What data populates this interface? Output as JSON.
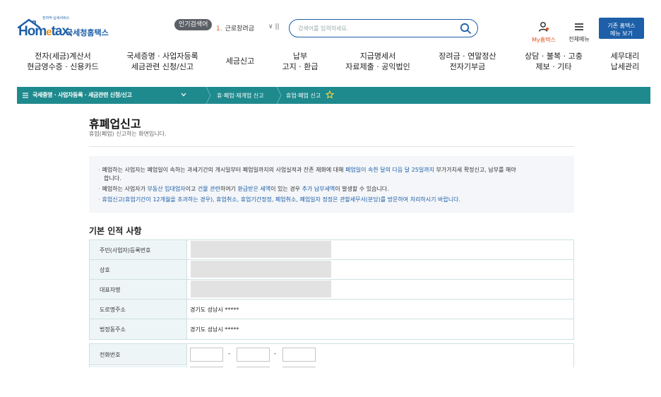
{
  "header": {
    "logo_tagline": "전자적 납세서비스",
    "logo_text_a": "Hom",
    "logo_text_e": "e",
    "logo_text_b": "tax.",
    "logo_kr": "국세청홈택스",
    "popular_badge": "인기검색어",
    "popular_rank": "1.",
    "popular_term": "근로장려금",
    "popular_ctrl": "∨  ||",
    "search_placeholder": "검색어를 입력하세요.",
    "my_hometax": "My홈택스",
    "all_menu": "전체메뉴",
    "legacy_line1": "기존 홈택스",
    "legacy_line2": "메뉴 보기"
  },
  "gnb": [
    {
      "line1": "전자(세금)계산서",
      "line2": "현금영수증 · 신용카드"
    },
    {
      "line1": "국세증명 · 사업자등록",
      "line2": "세금관련 신청/신고"
    },
    {
      "line1": "세금신고",
      "line2": ""
    },
    {
      "line1": "납부",
      "line2": "고지 · 환급"
    },
    {
      "line1": "지급명세서",
      "line2": "자료제출 · 공익법인"
    },
    {
      "line1": "장려금 · 연말정산",
      "line2": "전자기부금"
    },
    {
      "line1": "상담 · 불복 · 고충",
      "line2": "제보 · 기타"
    },
    {
      "line1": "세무대리",
      "line2": "납세관리"
    }
  ],
  "breadcrumb": {
    "level1": "국세증명 · 사업자등록 · 세금관련 신청/신고",
    "level2": "휴·폐업·재개업 신고",
    "level3": "휴업·폐업 신고"
  },
  "page": {
    "title": "휴폐업신고",
    "description": "휴업(폐업) 신고하는 화면입니다."
  },
  "notice": {
    "line1_a": "폐업하는 사업자는 폐업일이 속하는 과세기간의 개시일부터 폐업일까지의 사업실적과 잔존 재화에 대해 ",
    "line1_hl": "폐업일이 속한 달의 다음 달 25일까지",
    "line1_b": " 부가가치세 확정신고, 납부를 해야",
    "line1_c": "합니다.",
    "line2_a": "폐업하는 사업자가 ",
    "line2_hl1": "부동산 임대업자",
    "line2_b": "이고 ",
    "line2_hl2": "건물 관련",
    "line2_c": "하여기 ",
    "line2_hl3": "환급받은 세액",
    "line2_d": "이 있는 경우 ",
    "line2_hl4": "추가 납부세액",
    "line2_e": "이 발생할 수 있습니다.",
    "line3": "휴업신고(휴업기간이 12개월을 초과하는 경우), 휴업취소, 휴업기간정정, 폐업취소, 폐업일자 정정은 관할세무서(분당)를 방문하여 처리하시기 바랍니다."
  },
  "section": {
    "title": "기본 인적 사항",
    "rows": [
      {
        "label": "주민(사업자)등록번호",
        "value": ""
      },
      {
        "label": "상호",
        "value": ""
      },
      {
        "label": "대표자명",
        "value": ""
      },
      {
        "label": "도로명주소",
        "value": "경기도 성남시 *****"
      },
      {
        "label": "법정동주소",
        "value": "경기도 성남시 *****"
      }
    ]
  },
  "phone": {
    "label": "전화번호",
    "part1": "",
    "part2": "",
    "part3": "",
    "dash": "-"
  },
  "colors": {
    "brand_blue": "#1d5fa8",
    "accent_orange": "#f28b00",
    "breadcrumb_teal": "#1e8a8e",
    "highlight_blue": "#1d5fa8",
    "table_header_bg": "#eef5f6"
  }
}
